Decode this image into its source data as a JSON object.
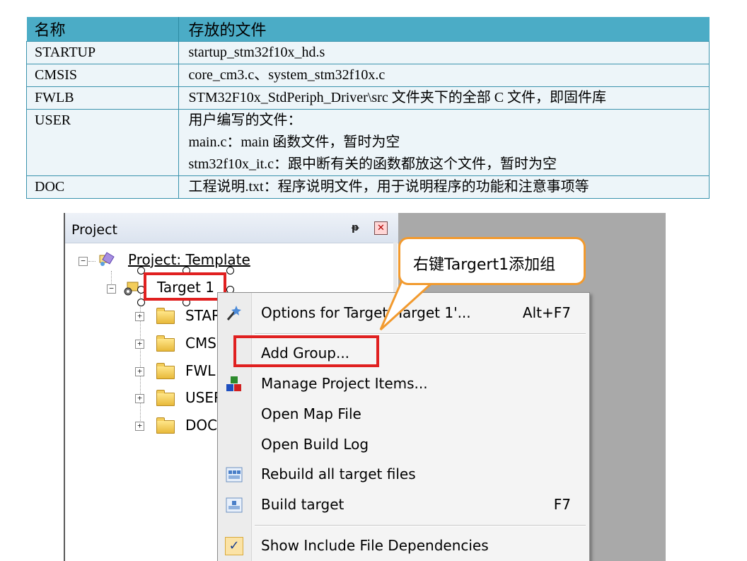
{
  "table": {
    "headers": [
      "名称",
      "存放的文件"
    ],
    "rows": [
      {
        "name": "STARTUP",
        "lines": [
          "startup_stm32f10x_hd.s"
        ]
      },
      {
        "name": "CMSIS",
        "lines": [
          "core_cm3.c、system_stm32f10x.c"
        ]
      },
      {
        "name": "FWLB",
        "lines": [
          "STM32F10x_StdPeriph_Driver\\src  文件夹下的全部 C 文件，即固件库"
        ]
      },
      {
        "name": "USER",
        "lines": [
          "用户编写的文件：",
          "main.c：main 函数文件，暂时为空",
          "stm32f10x_it.c：跟中断有关的函数都放这个文件，暂时为空"
        ]
      },
      {
        "name": "DOC",
        "lines": [
          "工程说明.txt：程序说明文件，用于说明程序的功能和注意事项等"
        ]
      }
    ]
  },
  "project_panel": {
    "title": "Project",
    "pin_glyph": "ᵽ",
    "close_glyph": "✕",
    "root": "Project: Template",
    "target": "Target 1",
    "groups": [
      "STAR",
      "CMS",
      "FWL",
      "USER",
      "DOC"
    ]
  },
  "context_menu": {
    "items": [
      {
        "label": "Options for Target 'Target 1'...",
        "shortcut": "Alt+F7",
        "icon": "wand-icon"
      },
      {
        "label": "Add Group...",
        "shortcut": "",
        "icon": ""
      },
      {
        "label": "Manage Project Items...",
        "shortcut": "",
        "icon": "blocks-icon"
      },
      {
        "label": "Open Map File",
        "shortcut": "",
        "icon": ""
      },
      {
        "label": "Open Build Log",
        "shortcut": "",
        "icon": ""
      },
      {
        "label": "Rebuild all target files",
        "shortcut": "",
        "icon": "rebuild-icon"
      },
      {
        "label": "Build target",
        "shortcut": "F7",
        "icon": "build-icon"
      },
      {
        "label": "Show Include File Dependencies",
        "shortcut": "",
        "icon": "checkmark-icon"
      }
    ]
  },
  "callout": {
    "text": "右键Targert1添加组"
  },
  "colors": {
    "header": "#4bacc6",
    "cell": "#edf5f9",
    "highlight": "#e02020",
    "callout_border": "#f29a2e"
  }
}
